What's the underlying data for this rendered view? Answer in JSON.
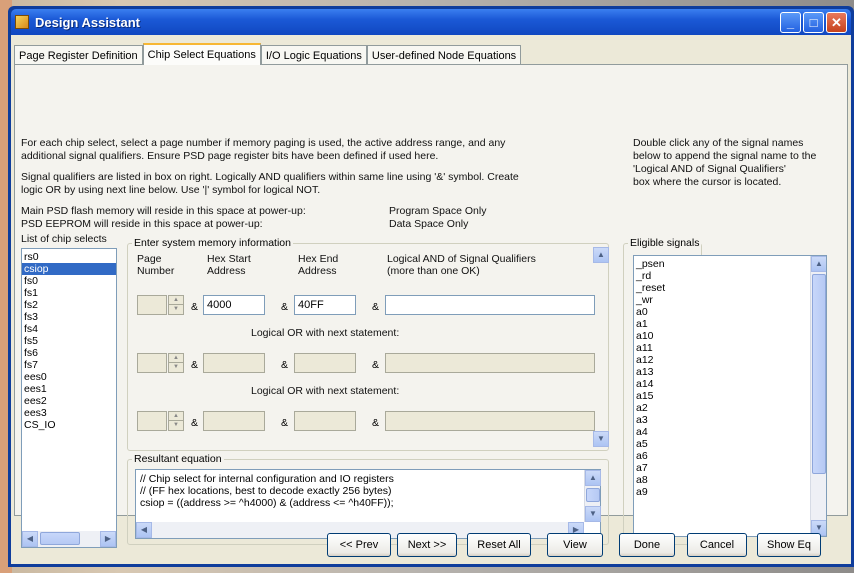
{
  "window": {
    "title": "Design Assistant"
  },
  "tabs": [
    {
      "label": "Page Register Definition"
    },
    {
      "label": "Chip Select Equations"
    },
    {
      "label": "I/O Logic Equations"
    },
    {
      "label": "User-defined Node Equations"
    }
  ],
  "instructions": {
    "line1": "For each chip select, select a page number if memory paging is used, the active address range, and any",
    "line2": "additional signal qualifiers. Ensure PSD page register bits have been defined if used here.",
    "line3": "Signal qualifiers are listed in box on right. Logically AND qualifiers within same line using '&' symbol. Create",
    "line4": "logic OR by using next line below. Use '|' symbol for logical NOT.",
    "flash_note": "Main PSD flash memory will reside in this space at power-up:",
    "flash_value": "Program Space Only",
    "eeprom_note": "PSD EEPROM will reside in this space at power-up:",
    "eeprom_value": "Data Space Only"
  },
  "right_help": {
    "line1": "Double click any of the signal names",
    "line2": "below to append the signal name to the",
    "line3": "'Logical AND of Signal Qualifiers'",
    "line4": "box where the cursor is located."
  },
  "chip_selects": {
    "label": "List of chip selects",
    "items": [
      "rs0",
      "csiop",
      "fs0",
      "fs1",
      "fs2",
      "fs3",
      "fs4",
      "fs5",
      "fs6",
      "fs7",
      "ees0",
      "ees1",
      "ees2",
      "ees3",
      "CS_IO"
    ],
    "selected": "csiop"
  },
  "memory_info": {
    "legend": "Enter system memory information",
    "col_page": "Page",
    "col_page2": "Number",
    "col_start": "Hex Start",
    "col_start2": "Address",
    "col_end": "Hex End",
    "col_end2": "Address",
    "col_and": "Logical AND of Signal Qualifiers",
    "col_and2": "(more than one OK)",
    "amp": "&",
    "rows": [
      {
        "page": "",
        "start": "4000",
        "end": "40FF",
        "qualifiers": ""
      },
      {
        "page": "",
        "start": "",
        "end": "",
        "qualifiers": ""
      },
      {
        "page": "",
        "start": "",
        "end": "",
        "qualifiers": ""
      }
    ],
    "or_label": "Logical OR with next statement:"
  },
  "resultant": {
    "legend": "Resultant equation",
    "line1": "// Chip select for internal configuration and IO registers",
    "line2": "// (FF hex locations, best to decode exactly 256 bytes)",
    "line3": "csiop = ((address >= ^h4000) & (address <= ^h40FF));"
  },
  "eligible": {
    "legend": "Eligible signals",
    "items": [
      "_psen",
      "_rd",
      "_reset",
      "_wr",
      "a0",
      "a1",
      "a10",
      "a11",
      "a12",
      "a13",
      "a14",
      "a15",
      "a2",
      "a3",
      "a4",
      "a5",
      "a6",
      "a7",
      "a8",
      "a9"
    ]
  },
  "buttons": {
    "prev": "<< Prev",
    "next": "Next >>",
    "reset": "Reset All",
    "view": "View",
    "done": "Done",
    "cancel": "Cancel",
    "show_eq": "Show Eq"
  },
  "title_buttons": {
    "minimize": "_",
    "maximize": "□",
    "close": "✕"
  },
  "colors": {
    "titlebar": "#1b59d6",
    "selection": "#316ac5",
    "face": "#ece9d8"
  }
}
